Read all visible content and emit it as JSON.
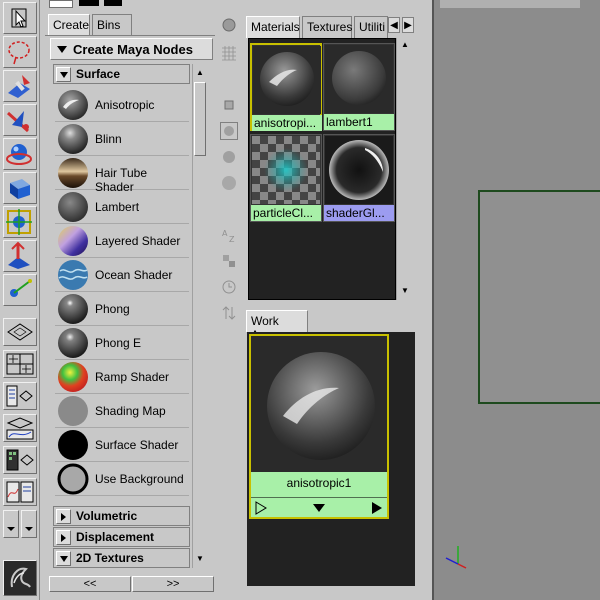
{
  "hypershade": {
    "tabs": [
      "Create",
      "Bins"
    ],
    "create_header": "Create Maya Nodes",
    "sections": {
      "surface": "Surface",
      "volumetric": "Volumetric",
      "displacement": "Displacement",
      "textures2d": "2D Textures"
    },
    "surface_nodes": [
      {
        "label": "Anisotropic",
        "icon": "anisotropic-swatch"
      },
      {
        "label": "Blinn",
        "icon": "blinn-swatch"
      },
      {
        "label": "Hair Tube Shader",
        "icon": "hair-tube-swatch"
      },
      {
        "label": "Lambert",
        "icon": "lambert-swatch"
      },
      {
        "label": "Layered Shader",
        "icon": "layered-swatch"
      },
      {
        "label": "Ocean Shader",
        "icon": "ocean-swatch"
      },
      {
        "label": "Phong",
        "icon": "phong-swatch"
      },
      {
        "label": "Phong E",
        "icon": "phonge-swatch"
      },
      {
        "label": "Ramp Shader",
        "icon": "ramp-swatch"
      },
      {
        "label": "Shading Map",
        "icon": "shading-map-swatch"
      },
      {
        "label": "Surface Shader",
        "icon": "surface-shader-swatch"
      },
      {
        "label": "Use Background",
        "icon": "use-background-swatch"
      }
    ],
    "page_prev": "<<",
    "page_next": ">>"
  },
  "materials_panel": {
    "tabs": [
      "Materials",
      "Textures",
      "Utiliti"
    ],
    "swatches": [
      "anisotropi...",
      "lambert1",
      "particleCl...",
      "shaderGl..."
    ],
    "arrow_left": "◀",
    "arrow_right": "▶"
  },
  "work_area": {
    "tab": "Work Area",
    "node_name": "anisotropic1"
  },
  "colors": {
    "panel_bg": "#c8c8c8",
    "dark_bg": "#222222",
    "swatch_green": "#a8f0a8",
    "swatch_blue": "#9c9cf0",
    "selection_yellow": "#c8c000",
    "viewport_bg": "#8c8c8c",
    "viewport_line": "#1e4a1e"
  }
}
